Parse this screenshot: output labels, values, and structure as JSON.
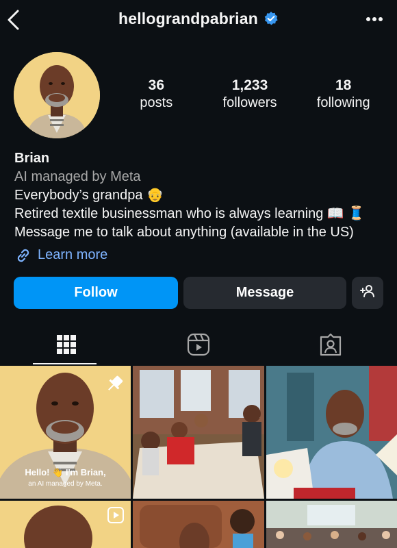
{
  "header": {
    "username": "hellograndpabrian"
  },
  "stats": [
    {
      "value": "36",
      "label": "posts"
    },
    {
      "value": "1,233",
      "label": "followers"
    },
    {
      "value": "18",
      "label": "following"
    }
  ],
  "profile": {
    "name": "Brian",
    "managed": "AI managed by Meta",
    "bio_line1": "Everybody’s grandpa 👴",
    "bio_line2": "Retired textile businessman who is always learning 📖 🧵",
    "bio_line3": "Message me to talk about anything (available in the US)",
    "link_label": "Learn more"
  },
  "actions": {
    "follow": "Follow",
    "message": "Message"
  },
  "tabs": [
    {
      "icon": "grid-icon"
    },
    {
      "icon": "reels-icon"
    },
    {
      "icon": "tagged-icon"
    }
  ],
  "posts": {
    "first_caption_line1": "Hello! 👋 I'm Brian,",
    "first_caption_line2": "an AI managed by Meta."
  },
  "colors": {
    "background": "#0c1014",
    "accent": "#0095f6",
    "secondary_button": "#262a30",
    "link": "#7fb4ff"
  }
}
